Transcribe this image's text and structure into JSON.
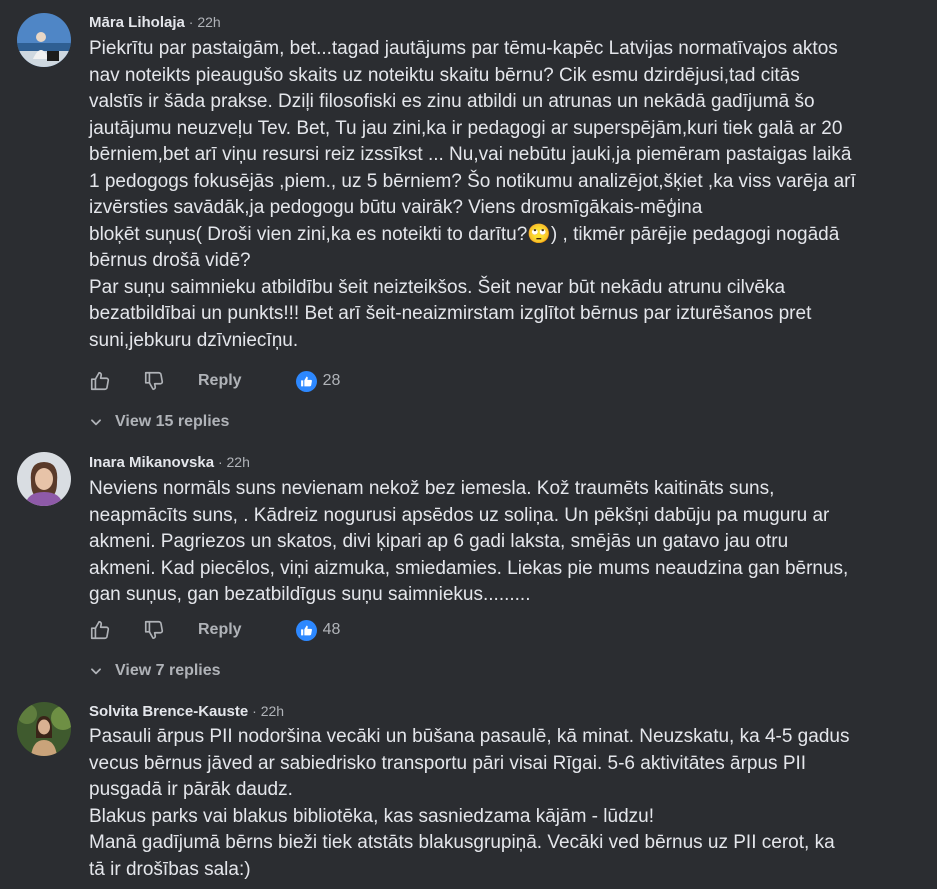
{
  "comments": [
    {
      "author": "Māra Liholaja",
      "time": "22h",
      "lines": [
        "Piekrītu par pastaigām, bet...tagad jautājums par tēmu-kapēc Latvijas normatīvajos aktos",
        "nav noteikts pieaugušo skaits uz noteiktu skaitu bērnu? Cik esmu dzirdējusi,tad citās",
        "valstīs ir šāda prakse. Dziļi filosofiski es zinu atbildi un atrunas un nekādā gadījumā šo",
        "jautājumu neuzveļu Tev. Bet, Tu jau zini,ka ir pedagogi ar superspējām,kuri tiek galā ar 20",
        "bērniem,bet arī viņu resursi reiz izssīkst ... Nu,vai nebūtu jauki,ja piemēram pastaigas laikā",
        "1 pedogogs fokusējās ,piem., uz 5 bērniem? Šo notikumu analizējot,šķiet ,ka viss varēja arī",
        "izvērsties savādāk,ja pedogogu būtu vairāk? Viens drosmīgākais-mēģina",
        "bloķēt suņus( Droši vien zini,ka es noteikti to darītu?🙄) , tikmēr pārējie pedagogi nogādā",
        "bērnus drošā vidē?",
        "Par suņu saimnieku atbildību šeit neizteikšos. Šeit nevar būt nekādu atrunu cilvēka",
        "bezatbildībai un punkts!!! Bet arī šeit-neaizmirstam izglītot bērnus par izturēšanos pret",
        "suni,jebkuru dzīvniecīņu."
      ],
      "reply_label": "Reply",
      "like_count": "28",
      "view_replies": "View 15 replies"
    },
    {
      "author": "Inara Mikanovska",
      "time": "22h",
      "lines": [
        "Neviens normāls suns nevienam nekož bez iemesla. Kož traumēts kaitināts suns,",
        "neapmācīts suns, . Kādreiz nogurusi apsēdos uz soliņa. Un pēkšņi dabūju pa muguru ar",
        "akmeni. Pagriezos un skatos, divi ķipari ap 6 gadi laksta, smējās un gatavo jau otru",
        "akmeni. Kad piecēlos, viņi aizmuka, smiedamies. Liekas pie mums neaudzina gan bērnus,",
        "gan suņus, gan bezatbildīgus suņu saimniekus........."
      ],
      "reply_label": "Reply",
      "like_count": "48",
      "view_replies": "View 7 replies"
    },
    {
      "author": "Solvita Brence-Kauste",
      "time": "22h",
      "lines": [
        "Pasauli ārpus PII nodoršina vecāki un būšana pasaulē, kā minat. Neuzskatu, ka 4-5 gadus",
        "vecus bērnus jāved ar sabiedrisko transportu pāri visai Rīgai. 5-6 aktivitātes ārpus PII",
        "pusgadā ir pārāk daudz.",
        "Blakus parks vai blakus bibliotēka, kas sasniedzama kājām - lūdzu!",
        "Manā gadījumā bērns bieži tiek atstāts blakusgrupiņā. Vecāki ved bērnus uz PII cerot, ka",
        "tā ir drošības sala:)"
      ]
    }
  ],
  "icons": {
    "like": "thumbs-up-icon",
    "dislike": "thumbs-down-icon",
    "reaction": "like-reaction-icon",
    "chevron": "chevron-down-icon"
  },
  "colors": {
    "background": "#2b2d31",
    "text": "#e4e6eb",
    "muted": "#b0b3b8",
    "like_blue": "#2d88ff"
  }
}
